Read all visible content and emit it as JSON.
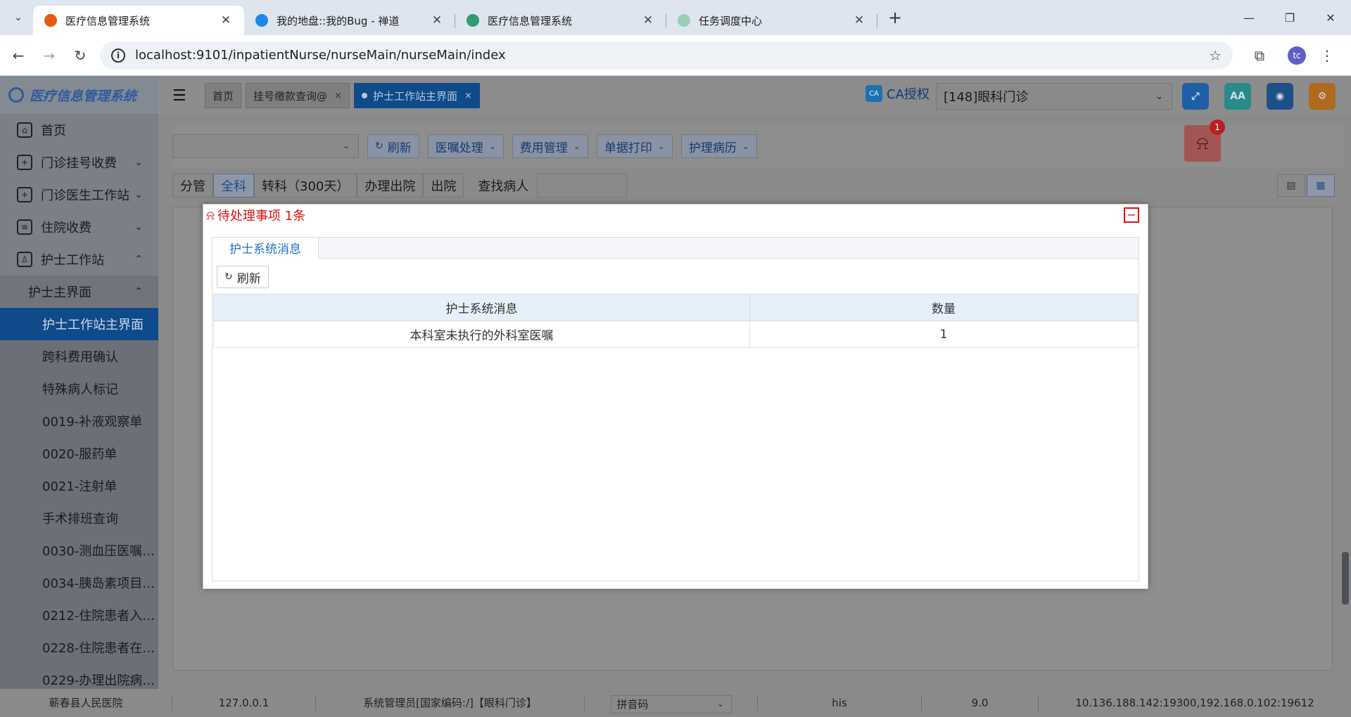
{
  "browser": {
    "tabs": [
      {
        "title": "医疗信息管理系统",
        "fav_color": "#e8590c",
        "active": true
      },
      {
        "title": "我的地盘::我的Bug - 禅道",
        "fav_color": "#1e88e5",
        "active": false
      },
      {
        "title": "医疗信息管理系统",
        "fav_color": "#2e9e6e",
        "active": false
      },
      {
        "title": "任务调度中心",
        "fav_color": "#9acfb8",
        "active": false
      }
    ],
    "url": "localhost:9101/inpatientNurse/nurseMain/nurseMain/index",
    "profile_initials": "tc"
  },
  "sidebar": {
    "logo_text": "医疗信息管理系统",
    "items": [
      {
        "label": "首页",
        "icon": "home-icon"
      },
      {
        "label": "门诊挂号收费",
        "icon": "register-icon"
      },
      {
        "label": "门诊医生工作站",
        "icon": "doctor-station-icon"
      },
      {
        "label": "住院收费",
        "icon": "inpatient-fee-icon"
      },
      {
        "label": "护士工作站",
        "icon": "nurse-station-icon"
      }
    ],
    "submenu": {
      "label": "护士主界面"
    },
    "leaves": [
      "护士工作站主界面",
      "跨科费用确认",
      "特殊病人标记",
      "0019-补液观察单",
      "0020-服药单",
      "0021-注射单",
      "手术排班查询",
      "0030-测血压医嘱…",
      "0034-胰岛素项目…",
      "0212-住院患者入…",
      "0228-住院患者在…",
      "0229-办理出院病…"
    ]
  },
  "topbar": {
    "page_tabs": [
      {
        "label": "首页"
      },
      {
        "label": "挂号缴款查询@"
      },
      {
        "label": "护士工作站主界面"
      }
    ],
    "ca_label": "CA授权",
    "ca_icon": "CA",
    "dept_selected": "[148]眼科门诊"
  },
  "toolbar": {
    "refresh_label": "刷新",
    "menus": [
      "医嘱处理",
      "费用管理",
      "单据打印",
      "护理病历"
    ],
    "alarm_count": "1"
  },
  "filters": {
    "tabs": [
      "分管",
      "全科",
      "转科（300天）",
      "办理出院",
      "出院"
    ],
    "active": "全科",
    "search_label": "查找病人"
  },
  "modal": {
    "title": "待处理事项 1条",
    "tab_label": "护士系统消息",
    "refresh_label": "刷新",
    "columns": [
      "护士系统消息",
      "数量"
    ],
    "rows": [
      {
        "message": "本科室未执行的外科室医嘱",
        "count": "1"
      }
    ]
  },
  "statusbar": {
    "hospital": "蕲春县人民医院",
    "ip": "127.0.0.1",
    "user": "系统管理员[国家编码:/]【眼科门诊】",
    "input_method": "拼音码",
    "db": "his",
    "version": "9.0",
    "servers": "10.136.188.142:19300,192.168.0.102:19612"
  }
}
